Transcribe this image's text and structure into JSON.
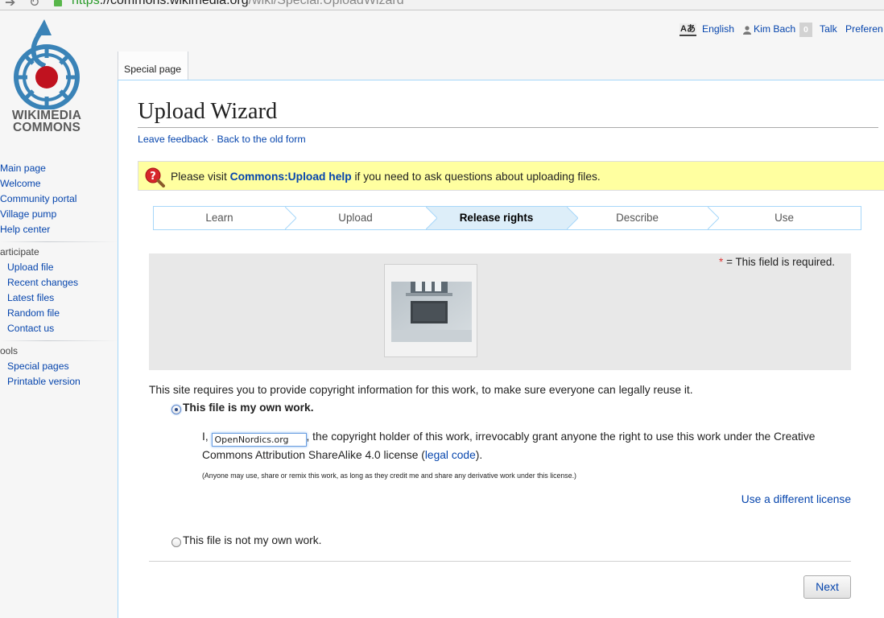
{
  "browser": {
    "url_scheme": "https",
    "url_host": "://commons.wikimedia.org",
    "url_path": "/wiki/Special:UploadWizard"
  },
  "logo": {
    "line1": "WIKIMEDIA",
    "line2": "COMMONS"
  },
  "sidebar": {
    "navigation": [
      "Main page",
      "Welcome",
      "Community portal",
      "Village pump",
      "Help center"
    ],
    "participate_heading": "articipate",
    "participate": [
      "Upload file",
      "Recent changes",
      "Latest files",
      "Random file",
      "Contact us"
    ],
    "tools_heading": "ools",
    "tools": [
      "Special pages",
      "Printable version"
    ]
  },
  "personal": {
    "language_icon": "Aあ",
    "language": "English",
    "user": "Kim Bach",
    "notifications": "0",
    "talk": "Talk",
    "preferences": "Preferen"
  },
  "tabs": {
    "special": "Special page"
  },
  "page": {
    "title": "Upload Wizard",
    "leave_feedback": "Leave feedback",
    "separator": " · ",
    "back_old_form": "Back to the old form"
  },
  "notice": {
    "before": "Please visit ",
    "link": "Commons:Upload help",
    "after": " if you need to ask questions about uploading files."
  },
  "steps": [
    {
      "label": "Learn",
      "active": false
    },
    {
      "label": "Upload",
      "active": false
    },
    {
      "label": "Release rights",
      "active": true
    },
    {
      "label": "Describe",
      "active": false
    },
    {
      "label": "Use",
      "active": false
    }
  ],
  "required_note": {
    "star": "*",
    "text": "= This field is required."
  },
  "deed": {
    "intro": "This site requires you to provide copyright information for this work, to make sure everyone can legally reuse it.",
    "own_work_label": "This file is my own work.",
    "own_work_selected": true,
    "grant_prefix": "I,",
    "author_value": "OpenNordics.org",
    "grant_text": ", the copyright holder of this work, irrevocably grant anyone the right to use this work under the Creative Commons Attribution ShareAlike 4.0 license (",
    "legal_code": "legal code",
    "grant_end": ").",
    "anyone_note": "(Anyone may use, share or remix this work, as long as they credit me and share any derivative work under this license.)",
    "different_license": "Use a different license",
    "not_own_label": "This file is not my own work.",
    "not_own_selected": false
  },
  "buttons": {
    "next": "Next"
  },
  "colors": {
    "link": "#0645ad",
    "notice_bg": "#ffffa0",
    "step_active_bg": "#ddeef9",
    "border_blue": "#a7d7f9",
    "logo_blue": "#3a83b7",
    "logo_red": "#c0121f"
  }
}
